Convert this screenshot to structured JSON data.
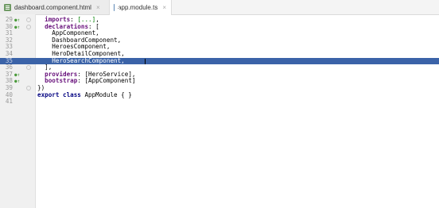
{
  "tabs": [
    {
      "label": "dashboard.component.html",
      "close": "×",
      "icon": "html-file-icon"
    },
    {
      "label": "app.module.ts",
      "close": "×",
      "icon": "ts-file-icon"
    }
  ],
  "editor": {
    "lines": [
      {
        "num": "29",
        "marker": true,
        "fold": true,
        "indent": "  ",
        "tokens": [
          {
            "cls": "pr",
            "text": "imports"
          },
          {
            "cls": "",
            "text": ": "
          },
          {
            "cls": "str",
            "text": "[...]"
          },
          {
            "cls": "",
            "text": ","
          }
        ]
      },
      {
        "num": "30",
        "marker": true,
        "fold": true,
        "indent": "  ",
        "tokens": [
          {
            "cls": "pr",
            "text": "declarations"
          },
          {
            "cls": "",
            "text": ": ["
          }
        ]
      },
      {
        "num": "31",
        "marker": false,
        "fold": false,
        "indent": "    ",
        "tokens": [
          {
            "cls": "",
            "text": "AppComponent,"
          }
        ]
      },
      {
        "num": "32",
        "marker": false,
        "fold": false,
        "indent": "    ",
        "tokens": [
          {
            "cls": "",
            "text": "DashboardComponent,"
          }
        ]
      },
      {
        "num": "33",
        "marker": false,
        "fold": false,
        "indent": "    ",
        "tokens": [
          {
            "cls": "",
            "text": "HeroesComponent,"
          }
        ]
      },
      {
        "num": "34",
        "marker": false,
        "fold": false,
        "indent": "    ",
        "tokens": [
          {
            "cls": "",
            "text": "HeroDetailComponent,"
          }
        ]
      },
      {
        "num": "35",
        "marker": false,
        "fold": false,
        "selected": true,
        "indent": "    ",
        "tokens": [
          {
            "cls": "",
            "text": "HeroSearchComponent,"
          }
        ]
      },
      {
        "num": "36",
        "marker": false,
        "fold": true,
        "indent": "  ",
        "tokens": [
          {
            "cls": "",
            "text": "],"
          }
        ]
      },
      {
        "num": "37",
        "marker": true,
        "fold": false,
        "indent": "  ",
        "tokens": [
          {
            "cls": "pr",
            "text": "providers"
          },
          {
            "cls": "",
            "text": ": [HeroService],"
          }
        ]
      },
      {
        "num": "38",
        "marker": true,
        "fold": false,
        "indent": "  ",
        "tokens": [
          {
            "cls": "pr",
            "text": "bootstrap"
          },
          {
            "cls": "",
            "text": ": [AppComponent]"
          }
        ]
      },
      {
        "num": "39",
        "marker": false,
        "fold": true,
        "indent": "",
        "tokens": [
          {
            "cls": "",
            "text": "})"
          }
        ]
      },
      {
        "num": "40",
        "marker": false,
        "fold": false,
        "indent": "",
        "tokens": [
          {
            "cls": "kw",
            "text": "export class"
          },
          {
            "cls": "",
            "text": " AppModule { }"
          }
        ]
      },
      {
        "num": "41",
        "marker": false,
        "fold": false,
        "indent": "",
        "tokens": []
      }
    ]
  },
  "colors": {
    "selection": "#3b63a8",
    "keyword": "#000080",
    "property": "#660e7a",
    "string": "#008000",
    "marker": "#4a9a3a"
  }
}
